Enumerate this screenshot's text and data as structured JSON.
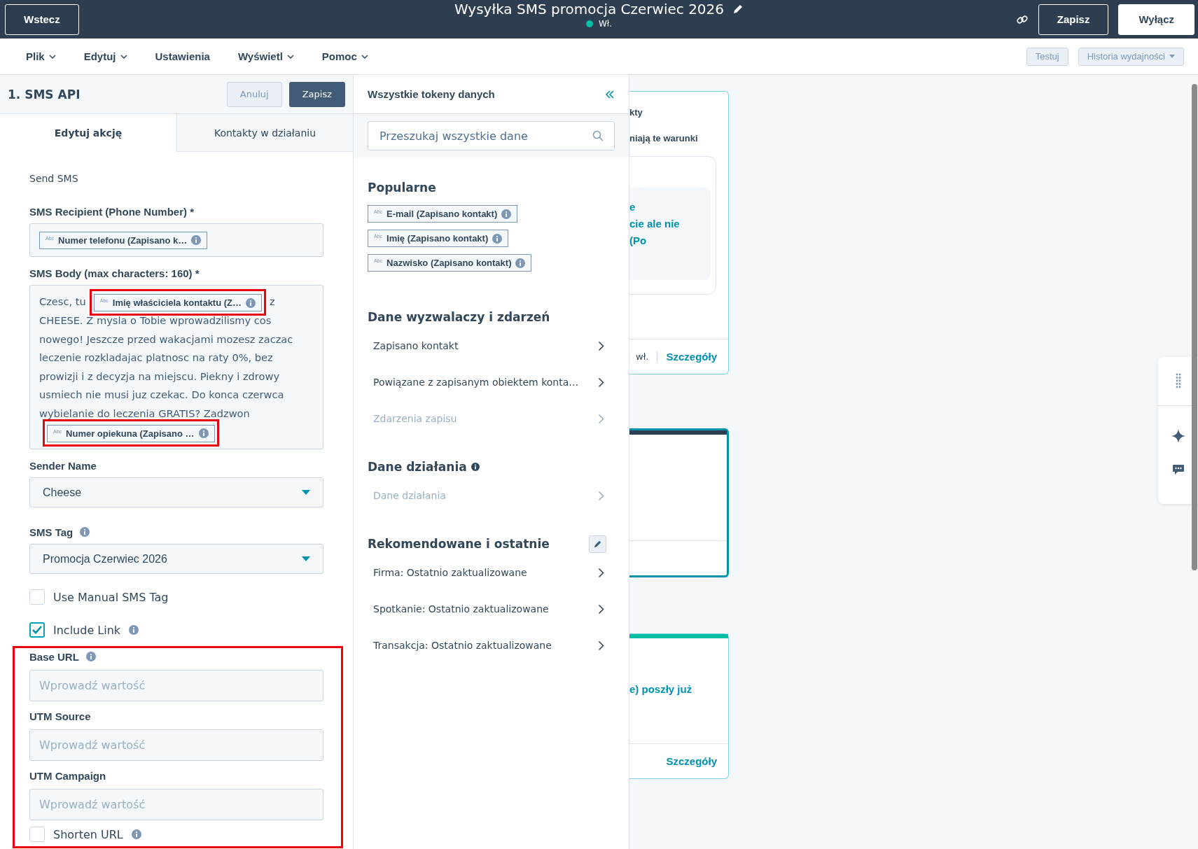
{
  "top_bar": {
    "back_button": "Wstecz",
    "title": "Wysyłka SMS promocja Czerwiec 2026",
    "status": {
      "label": "Wł.",
      "on": true
    },
    "save_button": "Zapisz",
    "off_button": "Wyłącz"
  },
  "menu": [
    {
      "label": "Plik",
      "dropdown": true
    },
    {
      "label": "Edytuj",
      "dropdown": true
    },
    {
      "label": "Ustawienia",
      "dropdown": false
    },
    {
      "label": "Wyświetl",
      "dropdown": true
    },
    {
      "label": "Pomoc",
      "dropdown": true
    }
  ],
  "menu_actions": [
    {
      "label": "Testuj",
      "dropdown": false
    },
    {
      "label": "Historia wydajności",
      "dropdown": true
    }
  ],
  "action_panel": {
    "title": "1. SMS API",
    "cancel_button": "Anuluj",
    "save_button": "Zapisz",
    "tabs": [
      {
        "label": "Edytuj akcję",
        "selected": true
      },
      {
        "label": "Kontakty w działaniu",
        "selected": false
      }
    ],
    "action_type": "Send SMS",
    "fields": [
      {
        "kind": "tokens",
        "label": "SMS Recipient (Phone Number) *",
        "info": false,
        "tokens": [
          {
            "type_label": "Abc",
            "label": "Numer telefonu (Zapisano k…"
          }
        ]
      },
      {
        "kind": "body",
        "label": "SMS Body (max characters: 160) *",
        "info": false,
        "segments": [
          {
            "kind": "text",
            "text": "Czesc, tu"
          },
          {
            "kind": "token",
            "type_label": "Abc",
            "label": "Imię właściciela kontaktu (Z…",
            "highlighted": true
          },
          {
            "kind": "text",
            "text": "z CHEESE. Z mysla o Tobie wprowadzilismy cos nowego! Jeszcze przed wakacjami mozesz zaczac leczenie rozkladajac platnosc na raty 0%, bez prowizji i z decyzja na miejscu. Piekny i zdrowy usmiech nie musi juz czekac. Do konca czerwca wybielanie do leczenia GRATIS? Zadzwon"
          },
          {
            "kind": "token",
            "type_label": "Abc",
            "label": "Numer opiekuna (Zapisano …",
            "highlighted": true
          }
        ]
      },
      {
        "kind": "select",
        "label": "Sender Name",
        "info": false,
        "value": "Cheese"
      },
      {
        "kind": "select",
        "label": "SMS Tag",
        "info": true,
        "value": "Promocja Czerwiec 2026"
      },
      {
        "kind": "checkbox",
        "label": "Use Manual SMS Tag",
        "info": false,
        "checked": false
      },
      {
        "kind": "checkbox",
        "label": "Include Link",
        "info": true,
        "checked": true
      }
    ],
    "link_settings": {
      "highlighted": true,
      "fields": [
        {
          "kind": "text",
          "label": "Base URL",
          "info": true,
          "placeholder": "Wprowadź wartość"
        },
        {
          "kind": "text",
          "label": "UTM Source",
          "info": false,
          "placeholder": "Wprowadź wartość"
        },
        {
          "kind": "text",
          "label": "UTM Campaign",
          "info": false,
          "placeholder": "Wprowadź wartość"
        },
        {
          "kind": "checkbox",
          "label": "Shorten URL",
          "info": true,
          "checked": false
        }
      ]
    }
  },
  "token_panel": {
    "title": "Wszystkie tokeny danych",
    "search": {
      "placeholder": "Przeszukaj wszystkie dane"
    },
    "sections": [
      {
        "kind": "chips",
        "title": "Popularne",
        "info": false,
        "editable": false,
        "chips": [
          {
            "type_label": "Abc",
            "label": "E-mail (Zapisano kontakt)"
          },
          {
            "type_label": "Abc",
            "label": "Imię (Zapisano kontakt)"
          },
          {
            "type_label": "Abc",
            "label": "Nazwisko (Zapisano kontakt)"
          }
        ]
      },
      {
        "kind": "list",
        "title": "Dane wyzwalaczy i zdarzeń",
        "info": false,
        "editable": false,
        "items": [
          {
            "label": "Zapisano kontakt",
            "disabled": false
          },
          {
            "label": "Powiązane z zapisanym obiektem konta…",
            "disabled": false
          },
          {
            "label": "Zdarzenia zapisu",
            "disabled": true
          }
        ]
      },
      {
        "kind": "list",
        "title": "Dane działania",
        "info": true,
        "editable": false,
        "items": [
          {
            "label": "Dane działania",
            "disabled": true
          }
        ]
      },
      {
        "kind": "list",
        "title": "Rekomendowane i ostatnie",
        "info": false,
        "editable": true,
        "items": [
          {
            "label": "Firma: Ostatnio zaktualizowane",
            "disabled": false
          },
          {
            "label": "Spotkanie: Ostatnio zaktualizowane",
            "disabled": false
          },
          {
            "label": "Transakcja: Ostatnio zaktualizowane",
            "disabled": false
          }
        ]
      }
    ]
  },
  "canvas": {
    "cards": [
      {
        "selected": false,
        "lines": [
          {
            "kind": "title",
            "text": "kty"
          },
          {
            "kind": "title",
            "text": "niają te warunki"
          }
        ],
        "inner_lines": [
          "e",
          "cie ale nie",
          "(Po"
        ],
        "footer": {
          "note": "wł.",
          "link": "Szczegóły"
        }
      },
      {
        "color": "#2d3e50",
        "selected": true
      },
      {
        "color": "#00bda5",
        "selected": false,
        "lines": [
          {
            "kind": "link",
            "text": "e) poszły już"
          }
        ],
        "footer": {
          "link": "Szczegóły"
        }
      }
    ]
  }
}
